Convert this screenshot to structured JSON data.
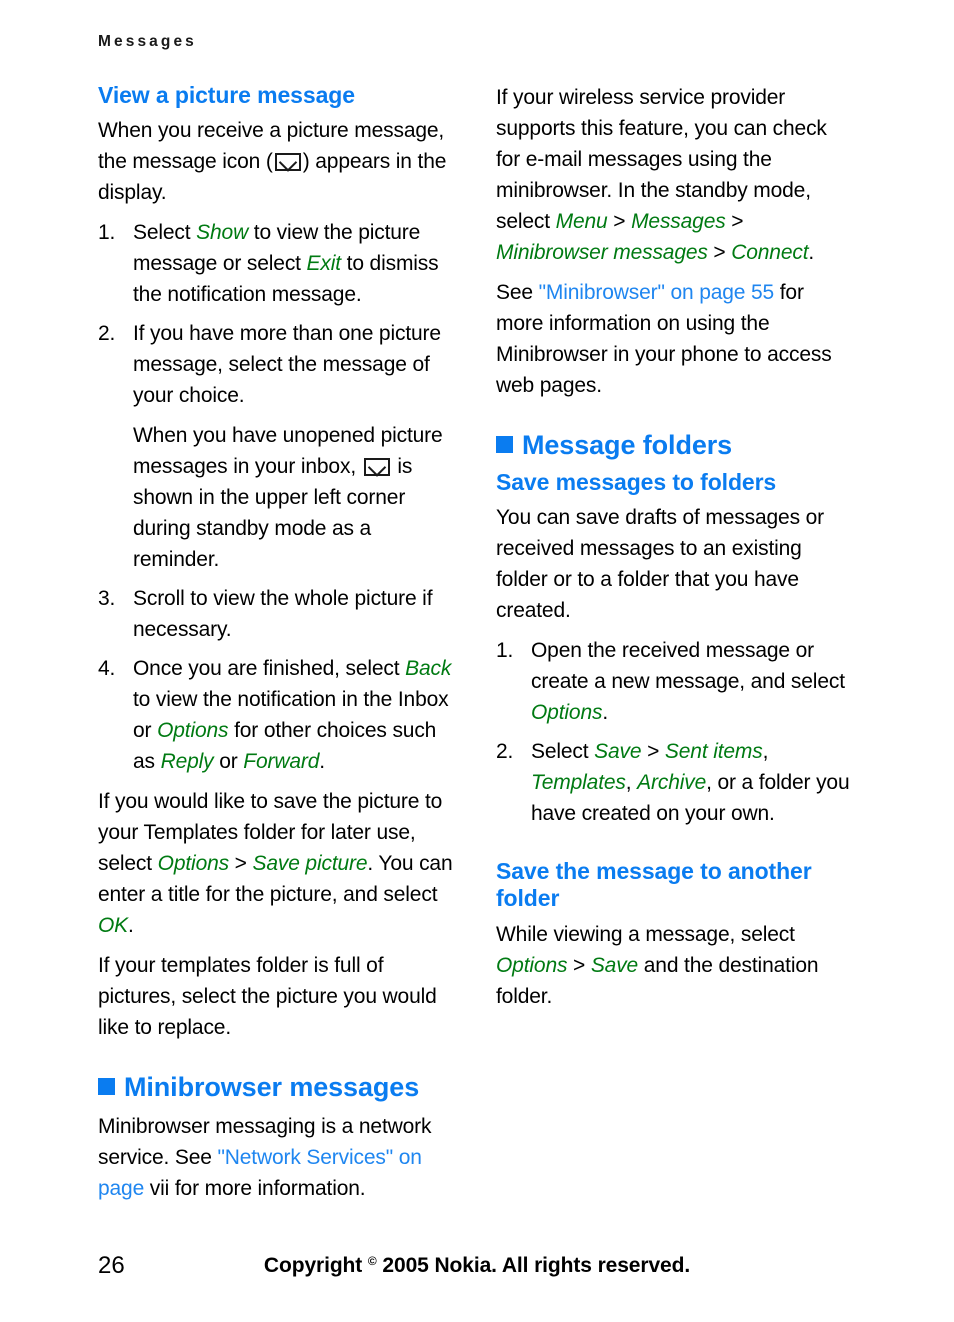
{
  "header": {
    "running_title": "Messages"
  },
  "colors": {
    "heading_blue": "#0a7cf0",
    "link_blue": "#1f86f0",
    "ui_term_green": "#007a12",
    "body_black": "#000000"
  },
  "left_column": {
    "heading": "View a picture message",
    "intro_part1": "When you receive a picture message, the message icon (",
    "intro_part2": ") appears in the display.",
    "steps": [
      {
        "num": "1.",
        "seg1": "Select ",
        "term1": "Show",
        "seg2": " to view the picture message or select ",
        "term2": "Exit",
        "seg3": " to dismiss the notification message."
      },
      {
        "num": "2.",
        "seg1": "If you have more than one picture message, select the message of your choice.",
        "sub_part1": "When you have unopened picture messages in your inbox, ",
        "sub_part2": " is shown in the upper left corner during standby mode as a reminder."
      },
      {
        "num": "3.",
        "seg1": "Scroll to view the whole picture if necessary."
      },
      {
        "num": "4.",
        "seg1": "Once you are finished, select ",
        "term1": "Back",
        "seg2": " to view the notification in the Inbox or ",
        "term2": "Options",
        "seg3": " for other choices such as ",
        "term3": "Reply",
        "seg4": " or ",
        "term4": "Forward",
        "seg5": "."
      }
    ],
    "para_save_picture": {
      "seg1": "If you would like to save the picture to your Templates folder for later use, select ",
      "term1": "Options",
      "seg2": " > ",
      "term2": "Save picture",
      "seg3": ". You can enter a title for the picture, and select ",
      "term3": "OK",
      "seg4": "."
    },
    "para_templates_full": "If your templates folder is full of pictures, select the picture you would like to replace.",
    "minibrowser_heading": "Minibrowser messages",
    "minibrowser_para": {
      "seg1": "Minibrowser messaging is a network service. See ",
      "link": "\"Network Services\" on page",
      "seg2": " vii for more information."
    }
  },
  "right_column": {
    "para_wireless": {
      "seg1": "If your wireless service provider supports this feature, you can check for e-mail messages using the minibrowser. In the standby mode, select ",
      "term1": "Menu",
      "seg2": " > ",
      "term2": "Messages",
      "seg3": " > ",
      "term3": "Minibrowser messages",
      "seg4": " > ",
      "term4": "Connect",
      "seg5": "."
    },
    "para_see_minibrowser": {
      "seg1": "See ",
      "link": "\"Minibrowser\" on page 55",
      "seg2": " for more information on using the Minibrowser in your phone to access web pages."
    },
    "message_folders_heading": "Message folders",
    "save_messages_heading": "Save messages to folders",
    "save_messages_para": "You can save drafts of messages or received messages to an existing folder or to a folder that you have created.",
    "steps": [
      {
        "num": "1.",
        "seg1": "Open the received message or create a new message, and select ",
        "term1": "Options",
        "seg2": "."
      },
      {
        "num": "2.",
        "seg1": "Select ",
        "term1": "Save",
        "seg2": " > ",
        "term2": "Sent items",
        "seg3": ", ",
        "term3": "Templates",
        "seg4": ", ",
        "term4": "Archive",
        "seg5": ", or a folder you have created on your own."
      }
    ],
    "another_folder_heading": "Save the message to another folder",
    "another_folder_para": {
      "seg1": "While viewing a message, select ",
      "term1": "Options",
      "seg2": " > ",
      "term2": "Save",
      "seg3": " and the destination folder."
    }
  },
  "footer": {
    "page_number": "26",
    "copyright_pre": "Copyright ",
    "copyright_symbol": "©",
    "copyright_post": " 2005 Nokia. All rights reserved."
  }
}
